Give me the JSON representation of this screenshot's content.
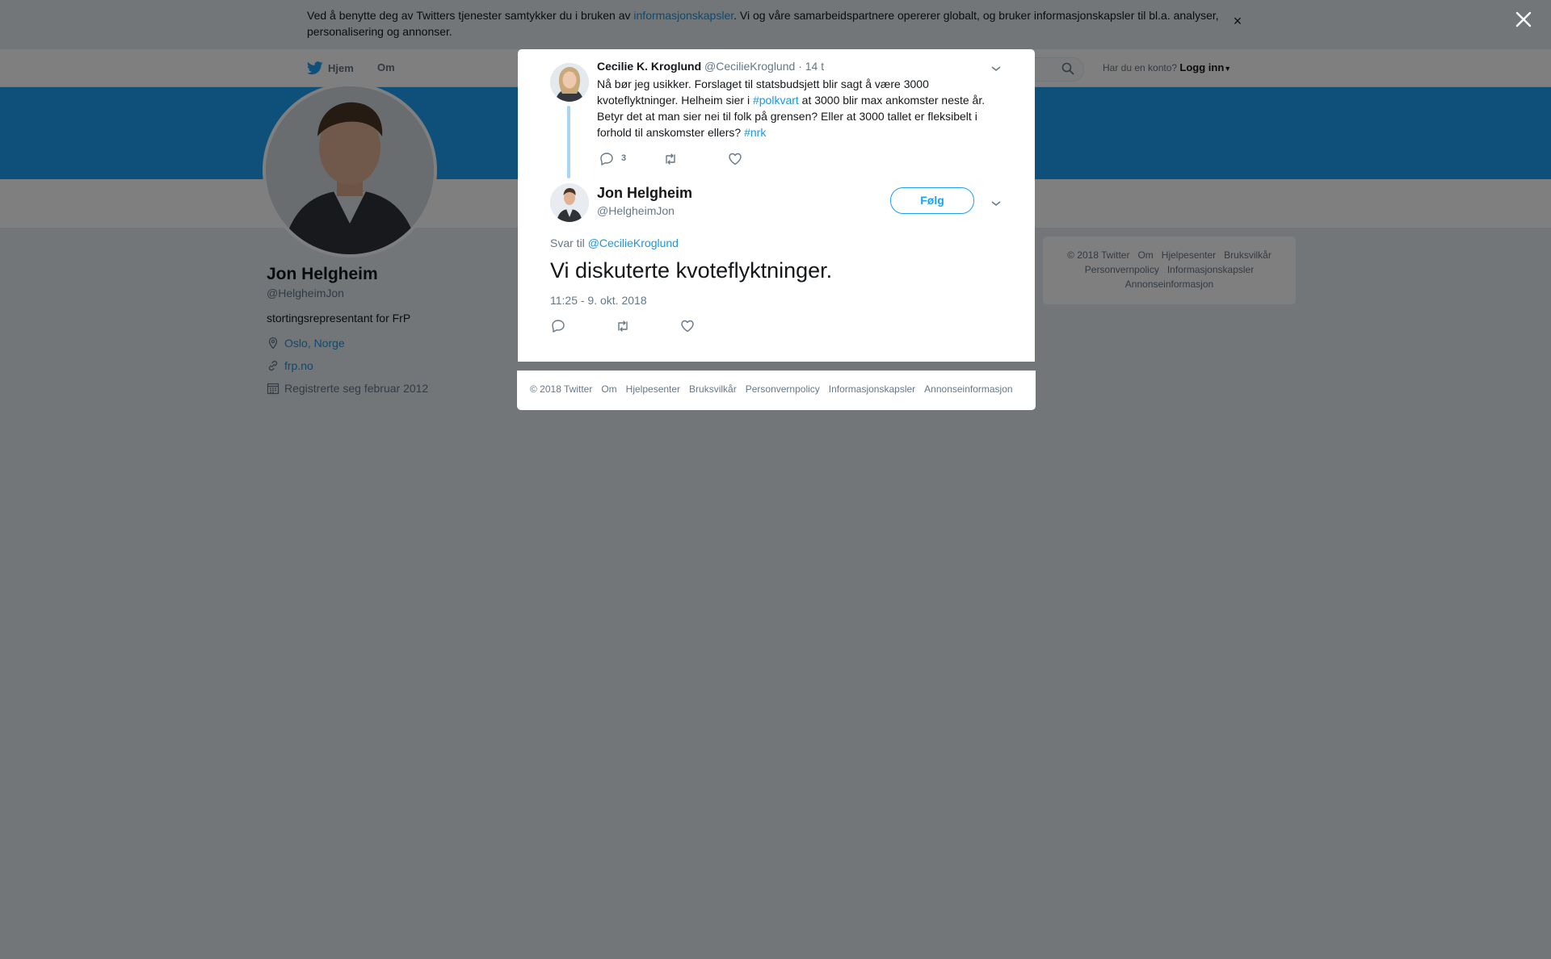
{
  "cookie_bar": {
    "text_before": "Ved å benytte deg av Twitters tjenester samtykker du i bruken av ",
    "link": "informasjonskapsler",
    "text_after": ". Vi og våre samarbeidspartnere opererer globalt, og bruker informasjonskapsler til bl.a. analyser, personalisering og annonser.",
    "close": "×"
  },
  "nav": {
    "home": "Hjem",
    "about": "Om",
    "login_prompt": "Har du en konto?",
    "login": "Logg inn"
  },
  "profile": {
    "name": "Jon Helgheim",
    "handle": "@HelgheimJon",
    "bio": "stortingsrepresentant for FrP",
    "location": "Oslo, Norge",
    "website": "frp.no",
    "joined": "Registrerte seg februar 2012"
  },
  "side_footer": {
    "items": [
      "© 2018 Twitter",
      "Om",
      "Hjelpesenter",
      "Bruksvilkår",
      "Personvernpolicy",
      "Informasjonskapsler",
      "Annonseinformasjon"
    ]
  },
  "parent_tweet": {
    "name": "Cecilie K. Kroglund",
    "handle": "@CecilieKroglund",
    "time": "14 t",
    "text_1": "Nå bør jeg usikker. Forslaget til statsbudsjett blir sagt å være 3000 kvoteflyktninger. Helheim sier i ",
    "hashtag_1": "#polkvart",
    "text_2": " at 3000 blir max ankomster neste år. Betyr det at man sier nei til folk på grensen? Eller at 3000 tallet er fleksibelt i forhold til anskomster ellers? ",
    "hashtag_2": "#nrk",
    "reply_count": "3"
  },
  "main_tweet": {
    "name": "Jon Helgheim",
    "handle": "@HelgheimJon",
    "follow_label": "Følg",
    "reply_to_prefix": "Svar til ",
    "reply_to_handle": "@CecilieKroglund",
    "text": "Vi diskuterte kvoteflyktninger.",
    "timestamp": "11:25 - 9. okt. 2018"
  },
  "modal_footer": {
    "items": [
      "© 2018 Twitter",
      "Om",
      "Hjelpesenter",
      "Bruksvilkår",
      "Personvernpolicy",
      "Informasjonskapsler",
      "Annonseinformasjon"
    ]
  },
  "colors": {
    "accent": "#1da1f2",
    "link": "#1b95e0",
    "overlay": "rgba(0,0,0,0.5)"
  }
}
